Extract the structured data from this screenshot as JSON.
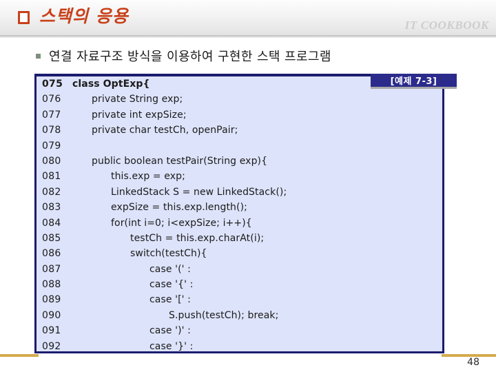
{
  "header": {
    "title": "스택의 응용",
    "bullet_icon": "square-outline-icon",
    "brand": "IT COOKBOOK"
  },
  "content": {
    "bullet_marker_icon": "square-bullet-icon",
    "bullet_text": "연결 자료구조 방식을 이용하여 구현한 스택 프로그램",
    "example_label": "[예제 7-3]"
  },
  "code": {
    "language": "java",
    "lines": [
      {
        "no": "075",
        "text": "class OptExp{",
        "indent": 0,
        "bold": true
      },
      {
        "no": "076",
        "text": "private String exp;",
        "indent": 4,
        "bold": false
      },
      {
        "no": "077",
        "text": "private int expSize;",
        "indent": 4,
        "bold": false
      },
      {
        "no": "078",
        "text": "private char testCh, openPair;",
        "indent": 4,
        "bold": false
      },
      {
        "no": "079",
        "text": "",
        "indent": 0,
        "bold": false
      },
      {
        "no": "080",
        "text": "public boolean testPair(String exp){",
        "indent": 4,
        "bold": false
      },
      {
        "no": "081",
        "text": "this.exp = exp;",
        "indent": 8,
        "bold": false
      },
      {
        "no": "082",
        "text": "LinkedStack S = new LinkedStack();",
        "indent": 8,
        "bold": false
      },
      {
        "no": "083",
        "text": "expSize = this.exp.length();",
        "indent": 8,
        "bold": false
      },
      {
        "no": "084",
        "text": "for(int i=0; i<expSize; i++){",
        "indent": 8,
        "bold": false
      },
      {
        "no": "085",
        "text": "testCh = this.exp.charAt(i);",
        "indent": 12,
        "bold": false
      },
      {
        "no": "086",
        "text": "switch(testCh){",
        "indent": 12,
        "bold": false
      },
      {
        "no": "087",
        "text": "case '(' :",
        "indent": 16,
        "bold": false
      },
      {
        "no": "088",
        "text": "case '{' :",
        "indent": 16,
        "bold": false
      },
      {
        "no": "089",
        "text": "case '[' :",
        "indent": 16,
        "bold": false
      },
      {
        "no": "090",
        "text": "S.push(testCh); break;",
        "indent": 20,
        "bold": false
      },
      {
        "no": "091",
        "text": "case ')' :",
        "indent": 16,
        "bold": false
      },
      {
        "no": "092",
        "text": "case '}' :",
        "indent": 16,
        "bold": false
      }
    ]
  },
  "footer": {
    "page_number": "48"
  },
  "colors": {
    "title": "#c8401a",
    "brand": "#cdcdcd",
    "code_bg": "#dde3fa",
    "code_border": "#1b1b6e",
    "badge_bg": "#2b2b8c",
    "footer_rule": "#d4ab4e",
    "bullet_marker": "#7e8f7e"
  }
}
